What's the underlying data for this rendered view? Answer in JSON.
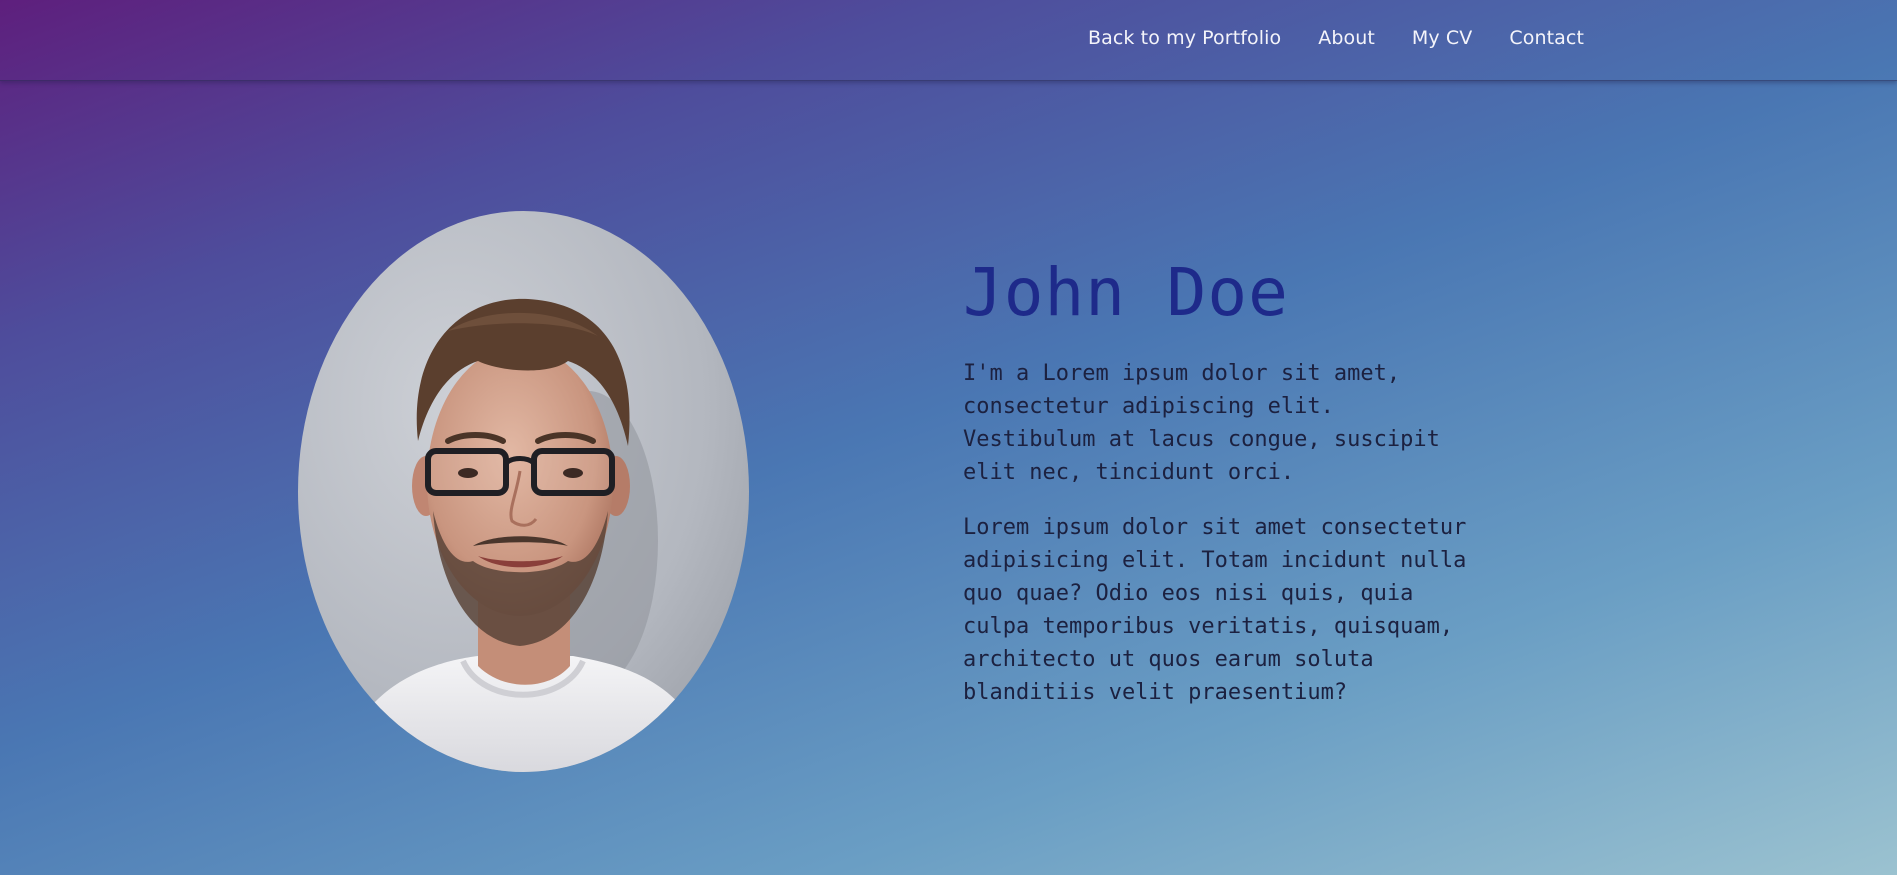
{
  "nav": {
    "items": [
      {
        "label": "Back to my Portfolio"
      },
      {
        "label": "About"
      },
      {
        "label": "My CV"
      },
      {
        "label": "Contact"
      }
    ]
  },
  "profile": {
    "name": "John Doe",
    "paragraphs": [
      "I'm a Lorem ipsum dolor sit amet,\nconsectetur adipiscing elit.\nVestibulum at lacus congue, suscipit\nelit nec, tincidunt orci.",
      "Lorem ipsum dolor sit amet consectetur\nadipisicing elit. Totam incidunt nulla\nquo quae? Odio eos nisi quis, quia\nculpa temporibus veritatis, quisquam,\narchitecto ut quos earum soluta\nblanditiis velit praesentium?"
    ]
  },
  "colors": {
    "gradient_start": "#5e1f7d",
    "gradient_mid": "#4a77b3",
    "gradient_end": "#9bc2d0",
    "name_color": "#1e2a8a",
    "text_color": "#1c2140",
    "nav_text": "#f4f4fa"
  }
}
